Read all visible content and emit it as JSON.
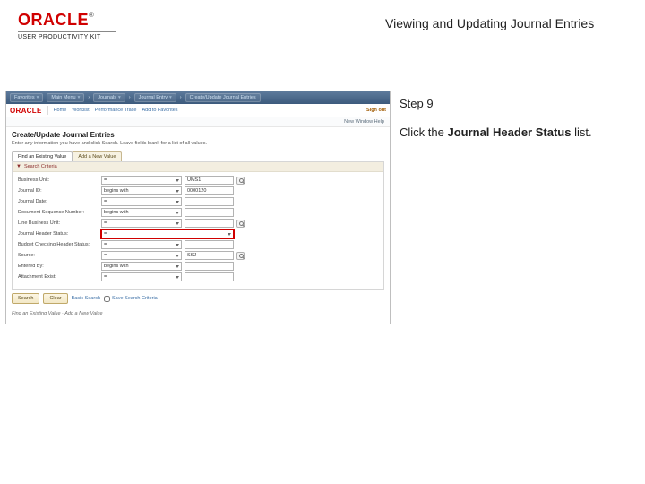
{
  "header": {
    "brand": "ORACLE",
    "brand_tm": "®",
    "upk": "USER PRODUCTIVITY KIT",
    "title": "Viewing and Updating Journal Entries"
  },
  "instructions": {
    "step": "Step 9",
    "text_before": "Click the ",
    "bold": "Journal Header Status",
    "text_after": " list."
  },
  "app": {
    "crumbs": [
      "Favorites",
      "Main Menu",
      "Journals",
      "Journal Entry",
      "Create/Update Journal Entries"
    ],
    "row2_links": [
      "Home",
      "Worklist",
      "Performance Trace",
      "Add to Favorites"
    ],
    "signout": "Sign out",
    "userbar": "New Window   Help",
    "page_title": "Create/Update Journal Entries",
    "page_desc": "Enter any information you have and click Search. Leave fields blank for a list of all values.",
    "tabs": [
      "Find an Existing Value",
      "Add a New Value"
    ],
    "panel_title": "Search Criteria",
    "rows": [
      {
        "label": "Business Unit:",
        "op": "=",
        "val": "UMS1"
      },
      {
        "label": "Journal ID:",
        "op": "begins with",
        "val": "0000120"
      },
      {
        "label": "Journal Date:",
        "op": "=",
        "val": ""
      },
      {
        "label": "Document Sequence Number:",
        "op": "begins with",
        "val": ""
      },
      {
        "label": "Line Business Unit:",
        "op": "=",
        "val": ""
      },
      {
        "label": "Journal Header Status:",
        "op": "=",
        "val": ""
      },
      {
        "label": "Budget Checking Header Status:",
        "op": "=",
        "val": ""
      },
      {
        "label": "Source:",
        "op": "=",
        "val": "SSJ"
      },
      {
        "label": "Entered By:",
        "op": "begins with",
        "val": ""
      },
      {
        "label": "Attachment Exist:",
        "op": "=",
        "val": ""
      }
    ],
    "buttons": {
      "search": "Search",
      "clear": "Clear",
      "basic": "Basic Search",
      "save": "Save Search Criteria"
    },
    "footer": "Find an Existing Value · Add a New Value"
  }
}
